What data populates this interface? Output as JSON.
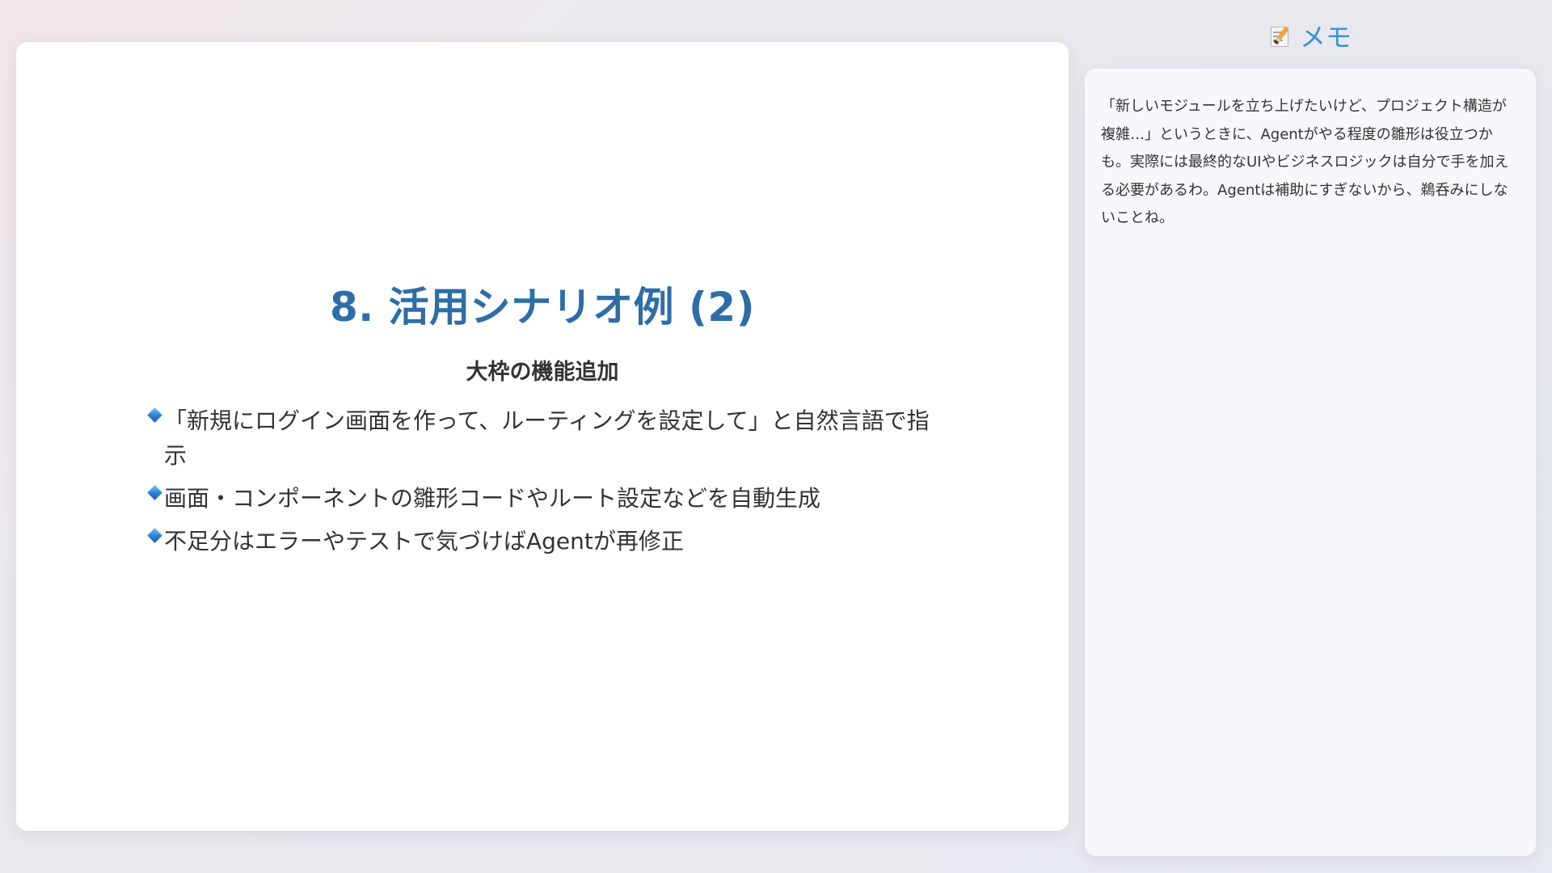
{
  "slide": {
    "title": "8. 活用シナリオ例 (2)",
    "subtitle": "大枠の機能追加",
    "bullets": [
      "「新規にログイン画面を作って、ルーティングを設定して」と自然言語で指示",
      "画面・コンポーネントの雛形コードやルート設定などを自動生成",
      "不足分はエラーやテストで気づけばAgentが再修正"
    ],
    "bullet_icon": "blue-diamond-icon",
    "title_color": "#2e6da7"
  },
  "memo": {
    "icon": "memo-icon",
    "title": "メモ",
    "title_color": "#3b8fd8",
    "text": "「新しいモジュールを立ち上げたいけど、プロジェクト構造が複雑…」というときに、Agentがやる程度の雛形は役立つかも。実際には最終的なUIやビジネスロジックは自分で手を加える必要があるわ。Agentは補助にすぎないから、鵜呑みにしないことね。"
  }
}
